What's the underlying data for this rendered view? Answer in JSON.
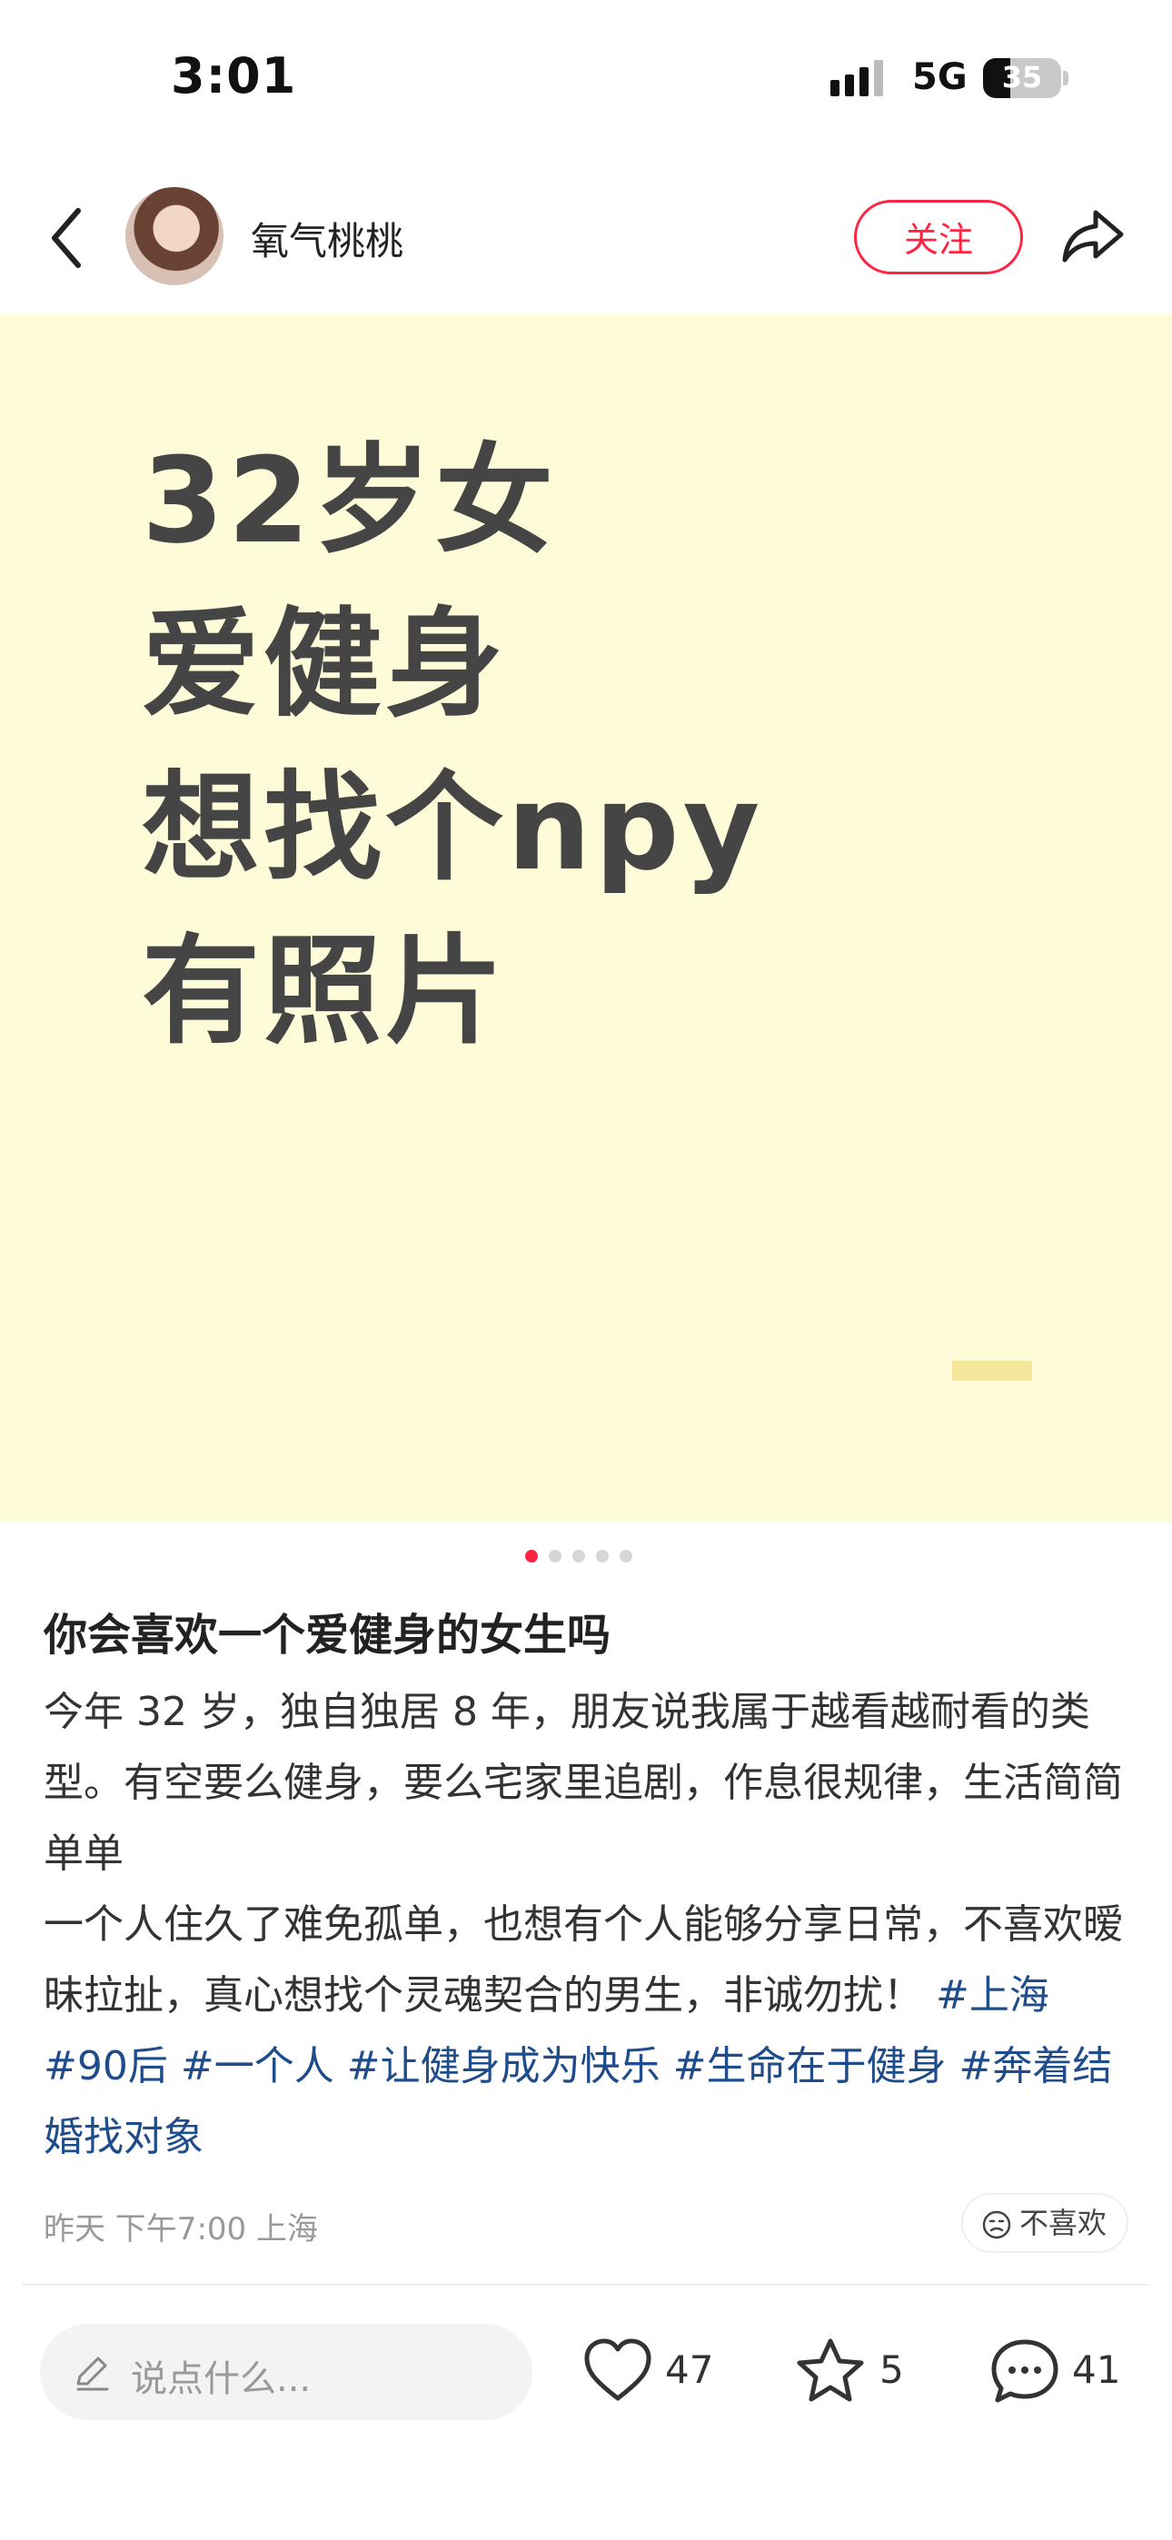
{
  "status_bar": {
    "time": "3:01",
    "network": "5G",
    "battery": "35"
  },
  "header": {
    "username": "氧气桃桃",
    "follow_label": "关注"
  },
  "hero": {
    "lines": [
      "32岁女",
      "爱健身",
      "想找个npy",
      "有照片"
    ]
  },
  "carousel": {
    "total": 5,
    "active": 1
  },
  "post": {
    "title": "你会喜欢一个爱健身的女生吗",
    "body_line1": "今年 32 岁，独自独居 8 年，朋友说我属于越看越耐看的类型。有空要么健身，要么宅家里追剧，作息很规律，生活简简单单",
    "body_line2": "一个人住久了难免孤单，也想有个人能够分享日常，不喜欢暧昧拉扯，真心想找个灵魂契合的男生，非诚勿扰！",
    "tags": [
      "#上海",
      "#90后",
      "#一个人",
      "#让健身成为快乐",
      "#生命在于健身",
      "#奔着结婚找对象"
    ],
    "meta": "昨天 下午7:00 上海",
    "dislike_label": "不喜欢"
  },
  "bottom_bar": {
    "comment_placeholder": "说点什么...",
    "likes": "47",
    "stars": "5",
    "comments": "41"
  }
}
